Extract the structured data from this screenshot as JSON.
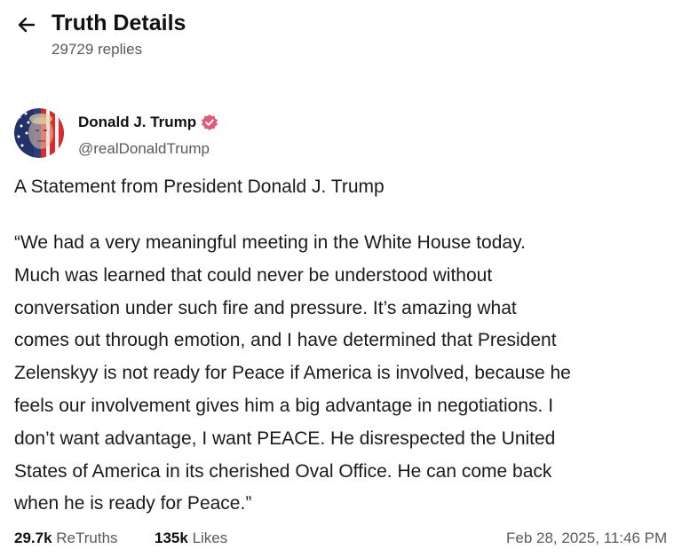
{
  "header": {
    "title": "Truth Details",
    "replies": "29729 replies",
    "back_icon": "arrow-left-icon"
  },
  "author": {
    "name": "Donald J. Trump",
    "handle": "@realDonaldTrump",
    "verified_icon": "verified-badge-icon",
    "verified_color": "#e05b7a"
  },
  "post": {
    "title": "A Statement from President Donald J. Trump",
    "lines": [
      "“We had a very meaningful meeting in the White House today.",
      "Much was learned that could never be understood without",
      "conversation under such fire and pressure. It’s amazing what",
      "comes out through emotion, and I have determined that President",
      "Zelenskyy is not ready for Peace if America is involved, because he",
      "feels our involvement gives him a big advantage in negotiations. I",
      "don’t want advantage, I want PEACE. He disrespected the United",
      "States of America in its cherished Oval Office. He can come back",
      "when he is ready for Peace.”"
    ]
  },
  "stats": {
    "retruths_count": "29.7k",
    "retruths_label": "ReTruths",
    "likes_count": "135k",
    "likes_label": "Likes",
    "timestamp": "Feb 28, 2025, 11:46 PM"
  }
}
